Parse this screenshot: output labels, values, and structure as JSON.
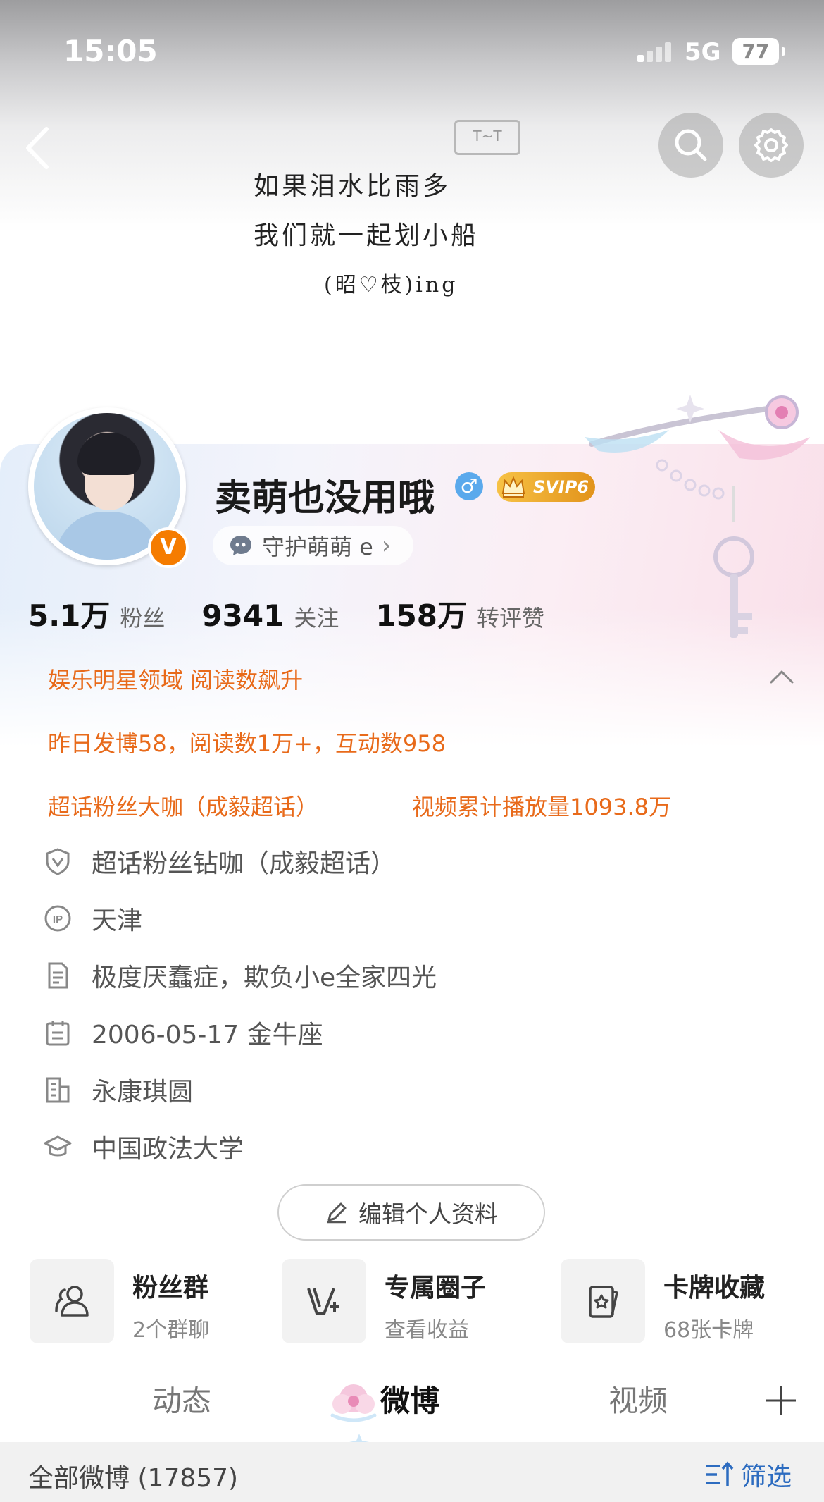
{
  "status_bar": {
    "time": "15:05",
    "network": "5G",
    "battery": "77"
  },
  "cover": {
    "lines": [
      "如果泪水比雨多",
      "我们就一起划小船",
      "(昭♡枝)ing"
    ],
    "mark": "T~T"
  },
  "profile": {
    "name": "卖萌也没用哦",
    "verified_badge": "V",
    "gender_symbol": "♂",
    "vip_label": "SVIP6",
    "guard_label": "守护萌萌 e",
    "guard_chevron": "›"
  },
  "stats": [
    {
      "value": "5.1万",
      "label": "粉丝"
    },
    {
      "value": "9341",
      "label": "关注"
    },
    {
      "value": "158万",
      "label": "转评赞"
    }
  ],
  "highlights": {
    "line1": "娱乐明星领域 阅读数飙升",
    "line2": "昨日发博58，阅读数1万+，互动数958",
    "line3_left": "超话粉丝大咖（成毅超话）",
    "line3_right": "视频累计播放量1093.8万"
  },
  "info": [
    {
      "icon": "shield-v-icon",
      "text": "超话粉丝钻咖（成毅超话）"
    },
    {
      "icon": "ip-icon",
      "text": "天津"
    },
    {
      "icon": "document-icon",
      "text": "极度厌蠢症，欺负小e全家四光"
    },
    {
      "icon": "calendar-icon",
      "text": "2006-05-17 金牛座"
    },
    {
      "icon": "building-icon",
      "text": "永康琪圆"
    },
    {
      "icon": "graduation-cap-icon",
      "text": "中国政法大学"
    }
  ],
  "edit_button": "编辑个人资料",
  "entries": [
    {
      "icon": "group-icon",
      "title": "粉丝群",
      "sub": "2个群聊"
    },
    {
      "icon": "circle-v-plus-icon",
      "title": "专属圈子",
      "sub": "查看收益"
    },
    {
      "icon": "card-star-icon",
      "title": "卡牌收藏",
      "sub": "68张卡牌"
    }
  ],
  "tabs": [
    "动态",
    "微博",
    "视频"
  ],
  "active_tab": "微博",
  "filter": {
    "title": "全部微博 (17857)",
    "button": "筛选"
  },
  "colors": {
    "accent_orange": "#e86a1a",
    "link_blue": "#2d6cc0",
    "vip_gold": "#f0b030"
  }
}
